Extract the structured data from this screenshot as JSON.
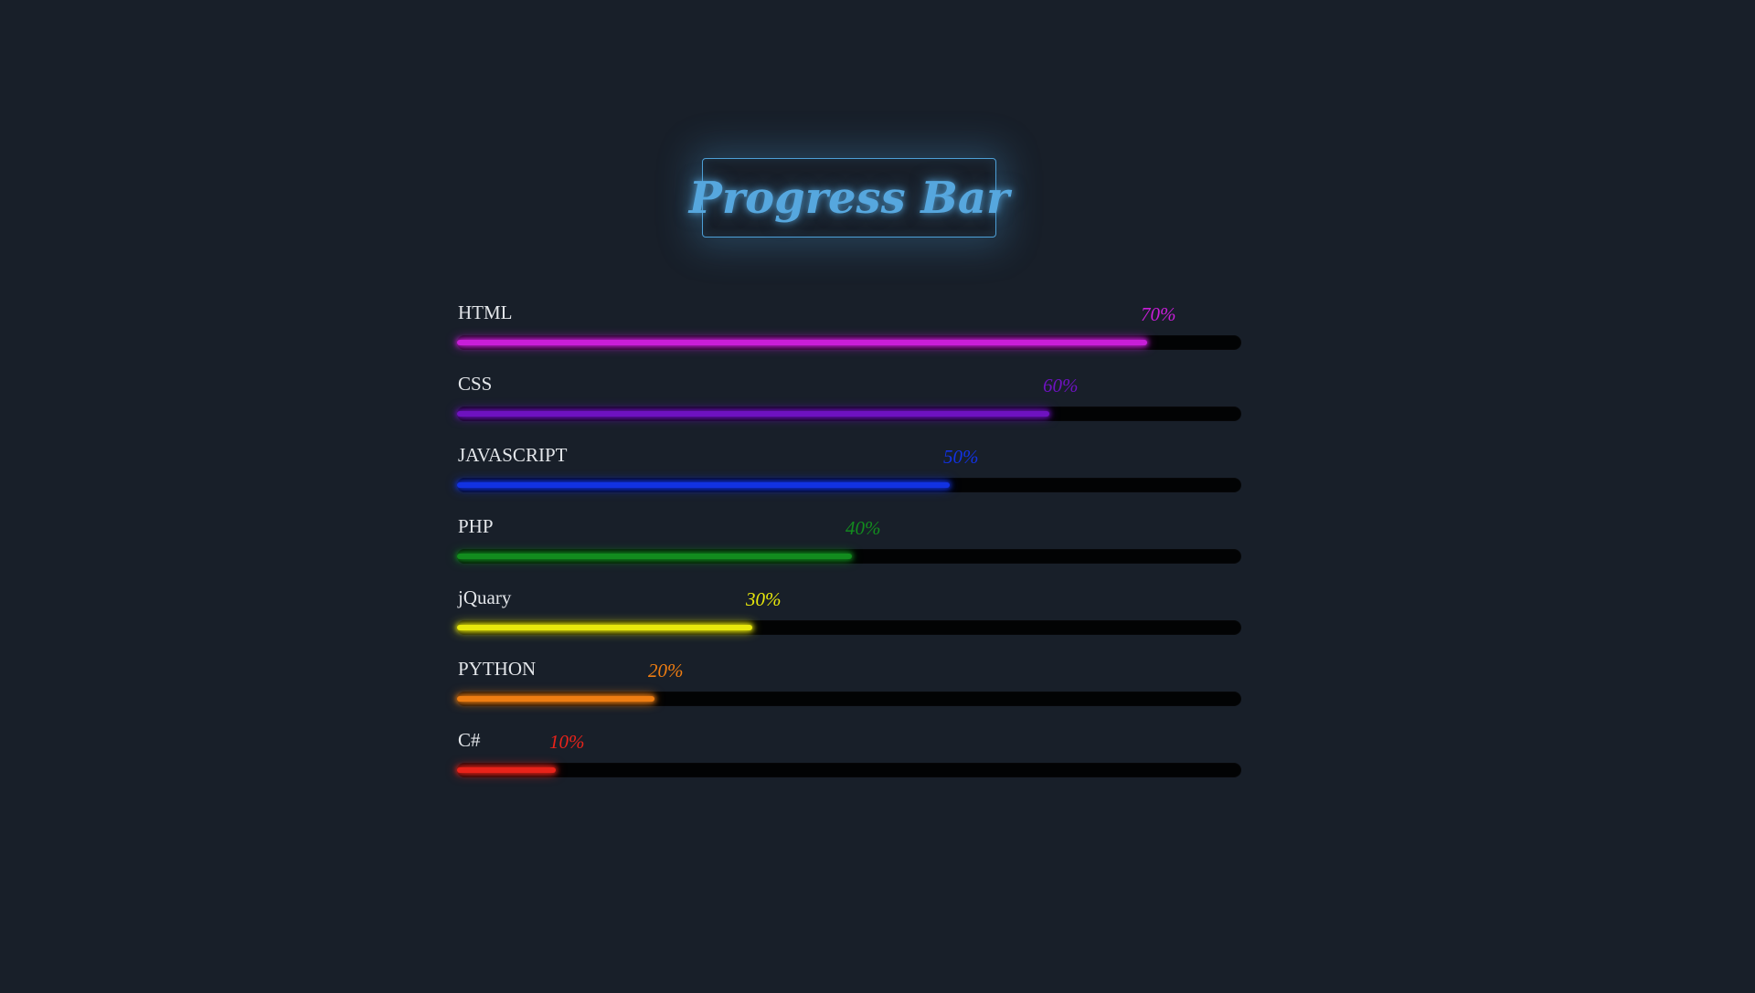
{
  "title": "Progress Bar",
  "skills": [
    {
      "name": "HTML",
      "percent_label": "70%",
      "fill_fraction": 0.88,
      "color": "#c81ed8"
    },
    {
      "name": "CSS",
      "percent_label": "60%",
      "fill_fraction": 0.755,
      "color": "#6e12c0"
    },
    {
      "name": "JAVASCRIPT",
      "percent_label": "50%",
      "fill_fraction": 0.628,
      "color": "#1232e2"
    },
    {
      "name": "PHP",
      "percent_label": "40%",
      "fill_fraction": 0.503,
      "color": "#128c1e"
    },
    {
      "name": "jQuary",
      "percent_label": "30%",
      "fill_fraction": 0.377,
      "color": "#e8e80c"
    },
    {
      "name": "PYTHON",
      "percent_label": "20%",
      "fill_fraction": 0.252,
      "color": "#ee7d12"
    },
    {
      "name": "C#",
      "percent_label": "10%",
      "fill_fraction": 0.126,
      "color": "#e8231a"
    }
  ]
}
